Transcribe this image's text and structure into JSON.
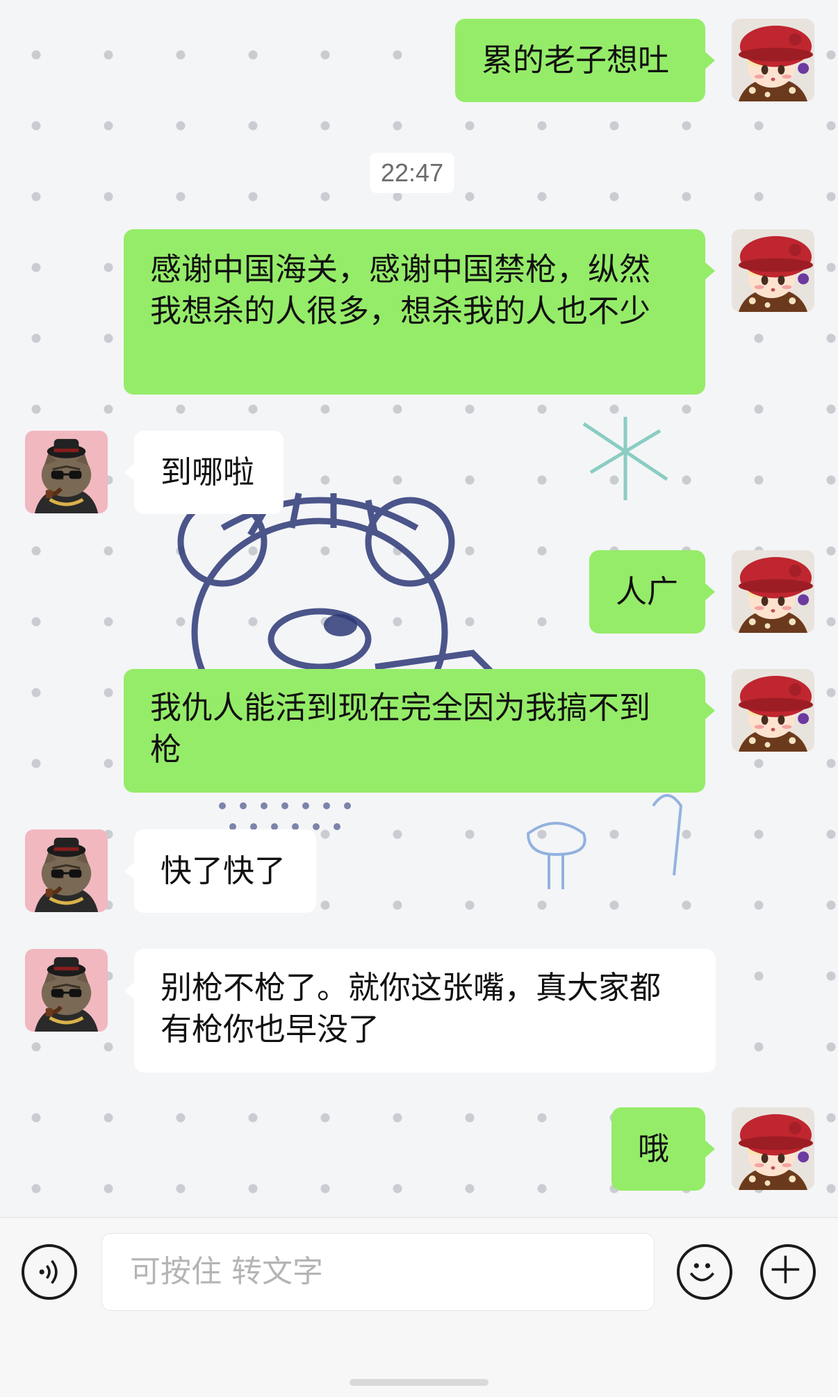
{
  "timestamp": "22:47",
  "messages": [
    {
      "side": "me",
      "text": "累的老子想吐"
    },
    {
      "side": "me",
      "text": "感谢中国海关，感谢中国禁枪，纵然我想杀的人很多，想杀我的人也不少"
    },
    {
      "side": "them",
      "text": "到哪啦"
    },
    {
      "side": "me",
      "text": "人广"
    },
    {
      "side": "me",
      "text": "我仇人能活到现在完全因为我搞不到枪"
    },
    {
      "side": "them",
      "text": "快了快了"
    },
    {
      "side": "them",
      "text": "别枪不枪了。就你这张嘴，真大家都有枪你也早没了"
    },
    {
      "side": "me",
      "text": "哦"
    }
  ],
  "input_bar": {
    "placeholder": "可按住 转文字",
    "voice_icon": "voice-icon",
    "emoji_icon": "emoji-icon",
    "plus_icon": "plus-icon"
  },
  "colors": {
    "my_bubble": "#95ec69",
    "their_bubble": "#ffffff",
    "background": "#f4f5f7"
  },
  "avatars": {
    "me": "anime-girl-red-hat-avatar",
    "them": "cat-sunglasses-avatar"
  }
}
